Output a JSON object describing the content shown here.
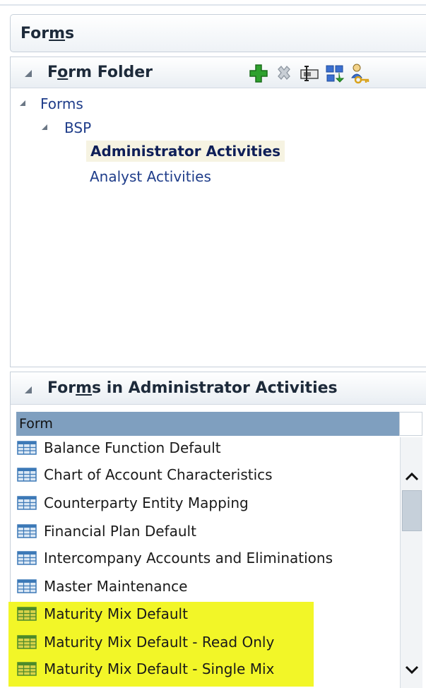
{
  "forms_panel": {
    "title_pre": "For",
    "title_u": "m",
    "title_post": "s"
  },
  "folder_panel": {
    "title_pre": "F",
    "title_u": "o",
    "title_post": "rm Folder",
    "toolbar": [
      {
        "name": "add-icon",
        "color": "#2ea12e"
      },
      {
        "name": "delete-icon",
        "color": "#9aa3ad"
      },
      {
        "name": "rename-icon",
        "color": "#5b5b5b"
      },
      {
        "name": "move-icon",
        "color": "#3a6fd0"
      },
      {
        "name": "assign-access-icon",
        "color": "#d9a21b"
      }
    ],
    "tree": {
      "root": "Forms",
      "child": "BSP",
      "leaves": [
        "Administrator Activities",
        "Analyst Activities"
      ],
      "selected_index": 0
    }
  },
  "forms_list_panel": {
    "title_pre": "For",
    "title_u": "m",
    "title_post": "s in Administrator Activities",
    "column_header": "Form",
    "rows": [
      {
        "label": "Balance Function Default",
        "highlight": false
      },
      {
        "label": "Chart of Account Characteristics",
        "highlight": false
      },
      {
        "label": "Counterparty Entity Mapping",
        "highlight": false
      },
      {
        "label": "Financial Plan Default",
        "highlight": false
      },
      {
        "label": "Intercompany Accounts and Eliminations",
        "highlight": false
      },
      {
        "label": "Master Maintenance",
        "highlight": false
      },
      {
        "label": "Maturity Mix Default",
        "highlight": true
      },
      {
        "label": "Maturity Mix Default - Read Only",
        "highlight": true
      },
      {
        "label": "Maturity Mix Default - Single Mix",
        "highlight": true
      }
    ],
    "highlight_color": "#f2f628"
  },
  "colors": {
    "accent_header": "#7f9fbf",
    "tree_link": "#1f3d8a",
    "selected_bg": "#f6f3e2"
  }
}
